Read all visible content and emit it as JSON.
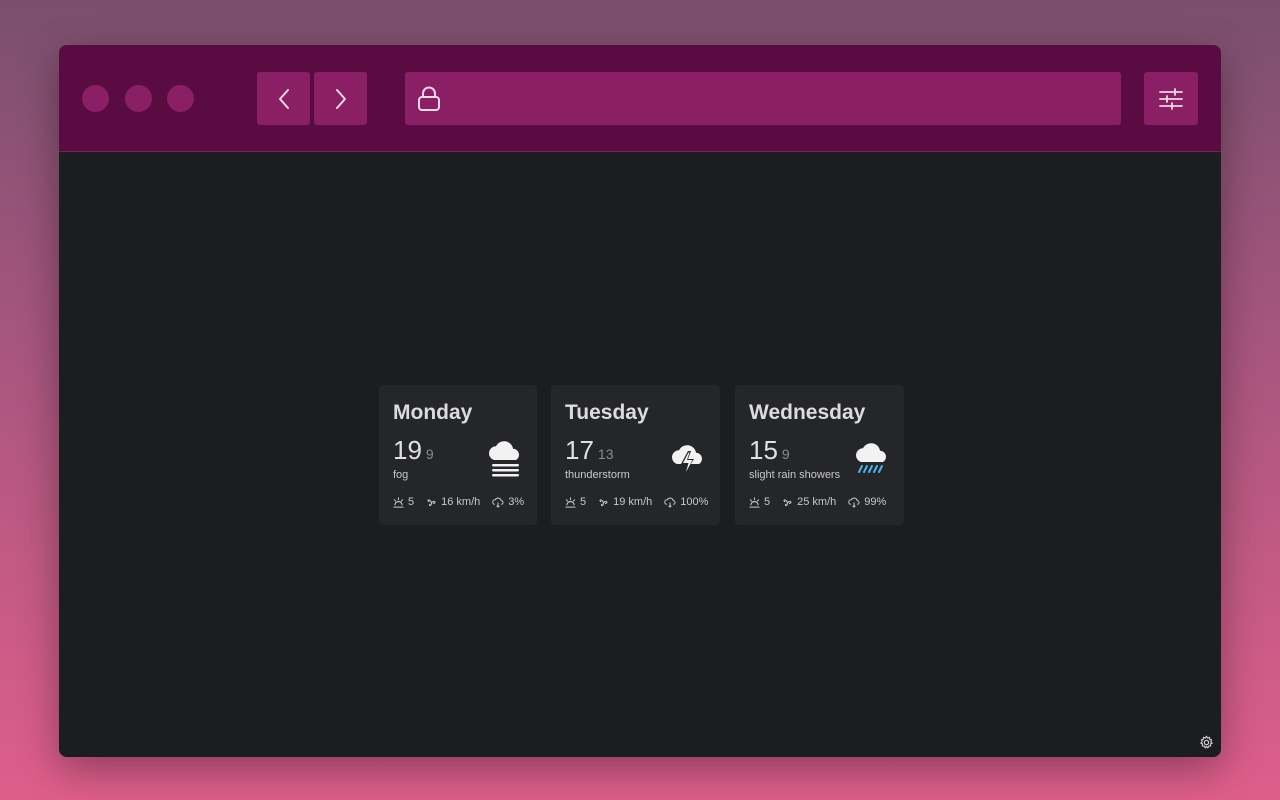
{
  "browser": {
    "address_value": "",
    "address_placeholder": ""
  },
  "forecast": [
    {
      "day": "Monday",
      "high": "19",
      "low": "9",
      "condition": "fog",
      "icon": "fog-icon",
      "uv": "5",
      "wind": "16 km/h",
      "precip": "3%"
    },
    {
      "day": "Tuesday",
      "high": "17",
      "low": "13",
      "condition": "thunderstorm",
      "icon": "thunderstorm-icon",
      "uv": "5",
      "wind": "19 km/h",
      "precip": "100%"
    },
    {
      "day": "Wednesday",
      "high": "15",
      "low": "9",
      "condition": "slight rain showers",
      "icon": "rain-showers-icon",
      "uv": "5",
      "wind": "25 km/h",
      "precip": "99%"
    }
  ],
  "colors": {
    "toolbar": "#5a0c42",
    "button": "#8a1f66",
    "content_bg": "#1c1d20",
    "card_bg": "#25262a",
    "rain_accent": "#4fb3e8"
  }
}
